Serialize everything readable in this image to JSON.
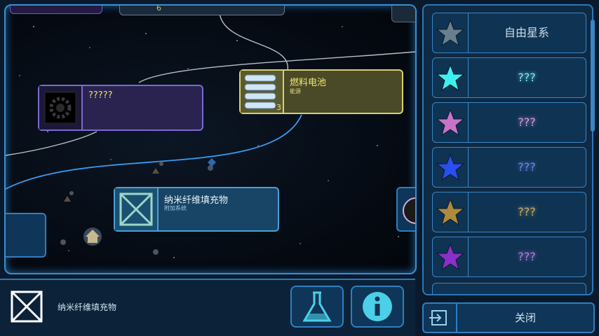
{
  "map": {
    "nodes": {
      "fuel_cell": {
        "name": "燃料电池",
        "category": "能源",
        "count": "3"
      },
      "unknown_tech": {
        "name": "?????"
      },
      "nanofiber": {
        "name": "纳米纤维填充物",
        "category": "附加系统"
      },
      "top_partial": {
        "count": "6"
      }
    }
  },
  "star_list": {
    "items": [
      {
        "label": "自由星系",
        "star_color": "#6a7f8e",
        "label_color": "#c8dcea"
      },
      {
        "label": "???",
        "star_color": "#3ff0f0",
        "label_color": "#7feaf0"
      },
      {
        "label": "???",
        "star_color": "#c873c8",
        "label_color": "#d59ad5"
      },
      {
        "label": "???",
        "star_color": "#2a4ef0",
        "label_color": "#6d88ea"
      },
      {
        "label": "???",
        "star_color": "#b08a3c",
        "label_color": "#c9ad6a"
      },
      {
        "label": "???",
        "star_color": "#8a30c8",
        "label_color": "#b57ad8"
      }
    ]
  },
  "close_button": {
    "label": "关闭"
  },
  "selected_item": {
    "name": "纳米纤维填充物"
  },
  "colors": {
    "frame": "#3b8fd0",
    "fuel_node_border": "#d8d070",
    "unknown_node_border": "#7a6ad0",
    "nanofiber_node_border": "#4aa0d8"
  }
}
